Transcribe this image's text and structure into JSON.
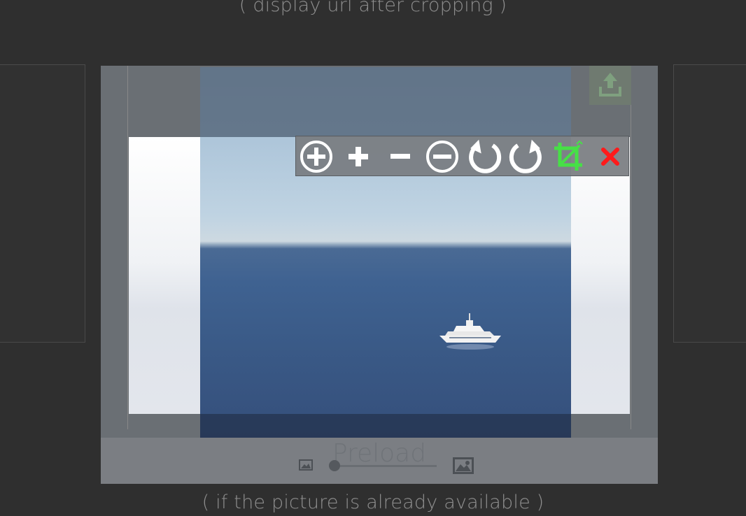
{
  "captions": {
    "top": "( display url after cropping )",
    "bottom": "( if the picture is already available )"
  },
  "cropper": {
    "preload_label": "Preload",
    "toolbar": [
      {
        "name": "zoom-in-circle-icon",
        "label": "zoom in"
      },
      {
        "name": "plus-icon",
        "label": "plus"
      },
      {
        "name": "minus-icon",
        "label": "minus"
      },
      {
        "name": "zoom-out-circle-icon",
        "label": "zoom out"
      },
      {
        "name": "rotate-left-icon",
        "label": "rotate left"
      },
      {
        "name": "rotate-right-icon",
        "label": "rotate right"
      },
      {
        "name": "crop-confirm-icon",
        "label": "crop"
      },
      {
        "name": "close-icon",
        "label": "close"
      }
    ],
    "zoom_slider_value": 0,
    "colors": {
      "toolbar_icon": "#ffffff",
      "crop_icon": "#46e046",
      "close_icon": "#ff1a1a",
      "upload_icon": "#7fa07f"
    }
  }
}
